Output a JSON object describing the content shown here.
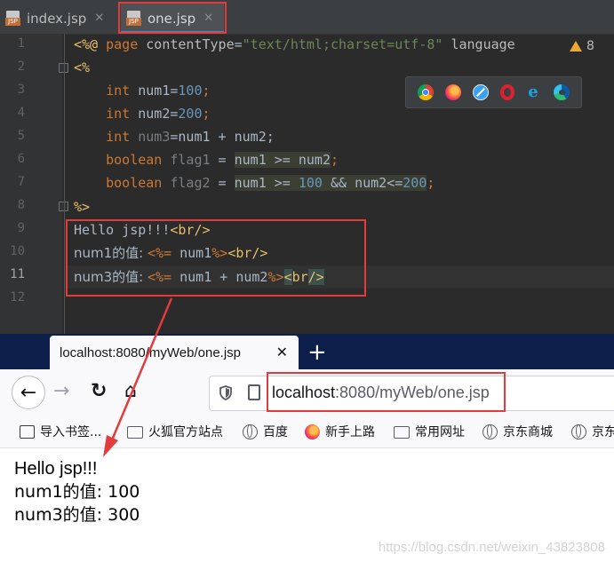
{
  "ide": {
    "tabs": [
      {
        "badge": "JSP",
        "label": "index.jsp",
        "close": "✕"
      },
      {
        "badge": "JSP",
        "label": "one.jsp",
        "close": "✕"
      }
    ],
    "line_numbers": [
      "1",
      "2",
      "3",
      "4",
      "5",
      "6",
      "7",
      "8",
      "9",
      "10",
      "11",
      "12"
    ],
    "warnings_count": "8",
    "code": {
      "l1": {
        "open": "<%@ ",
        "page": "page",
        "ct_attr": " contentType",
        "eq": "=",
        "ct_val": "\"text/html;charset=utf-8\"",
        "lang_attr": " language"
      },
      "l2": "<%",
      "l3": {
        "type": "int",
        "rest": " num1=",
        "num": "100",
        "end": ";"
      },
      "l4": {
        "type": "int",
        "rest": " num2=",
        "num": "200",
        "end": ";"
      },
      "l5": {
        "type": "int",
        "var": " num3",
        "rest": "=num1 + num2;"
      },
      "l6": {
        "type": "boolean",
        "var": " flag1",
        "eq": " = ",
        "expr": "num1 >= num2",
        "end": ";"
      },
      "l7": {
        "type": "boolean",
        "var": " flag2",
        "eq": " = ",
        "expr_a": "num1 >= ",
        "num": "100",
        "expr_b": " && num2<=",
        "num2": "200",
        "end": ";"
      },
      "l8": "%>",
      "l9": {
        "text": "Hello jsp!!!",
        "tag": "<br/>"
      },
      "l10": {
        "text": "num1的值: ",
        "open": "<%=",
        "expr": " num1",
        "close": "%>",
        "tag": "<br/>"
      },
      "l11": {
        "text": "num3的值: ",
        "open": "<%=",
        "expr": " num1 + num2",
        "close": "%>",
        "tag_a": "<",
        "tag_b": "br",
        "tag_c": "/>"
      }
    },
    "browser_icons": [
      "chrome-icon",
      "firefox-icon",
      "safari-icon",
      "opera-icon",
      "ie-icon",
      "edge-icon"
    ]
  },
  "browser": {
    "tab_title": "localhost:8080/myWeb/one.jsp",
    "tab_close": "✕",
    "new_tab": "+",
    "back": "←",
    "forward": "→",
    "reload": "↻",
    "home": "⌂",
    "url_host": "localhost",
    "url_rest": ":8080/myWeb/one.jsp",
    "bookmarks": [
      {
        "label": "导入书签...",
        "icon": "import-icon"
      },
      {
        "label": "火狐官方站点",
        "icon": "folder-icon"
      },
      {
        "label": "百度",
        "icon": "globe-icon"
      },
      {
        "label": "新手上路",
        "icon": "firefox-icon"
      },
      {
        "label": "常用网址",
        "icon": "folder-icon"
      },
      {
        "label": "京东商城",
        "icon": "globe-icon"
      },
      {
        "label": "京东",
        "icon": "globe-icon"
      }
    ],
    "page": {
      "line1": "Hello jsp!!!",
      "line2": "num1的值: 100",
      "line3": "num3的值: 300"
    },
    "watermark": "https://blog.csdn.net/weixin_43823808"
  },
  "colors": {
    "annotation_red": "#e23b3b",
    "ide_bg": "#2b2b2b",
    "keyword": "#cc7832",
    "number": "#6897bb",
    "string": "#6a8759"
  }
}
